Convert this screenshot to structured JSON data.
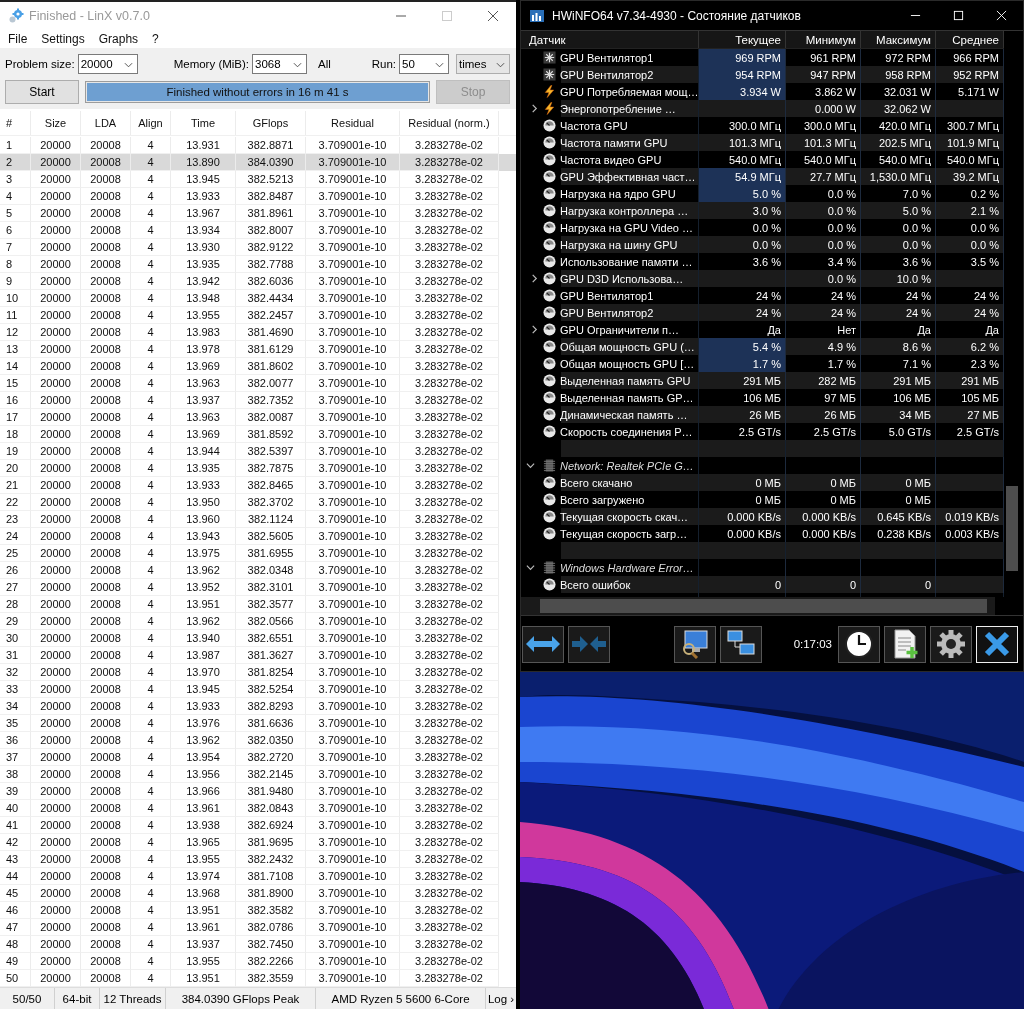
{
  "linx": {
    "title": "Finished - LinX v0.7.0",
    "menu": [
      "File",
      "Settings",
      "Graphs",
      "?"
    ],
    "problem_size": {
      "label": "Problem size:",
      "value": "20000"
    },
    "memory": {
      "label": "Memory (MiB):",
      "value": "3068"
    },
    "all_label": "All",
    "run": {
      "label": "Run:",
      "value": "50",
      "unit": "times"
    },
    "start_button": {
      "label": "Start",
      "disabled": false
    },
    "progress": {
      "text": "Finished without errors in 16 m 41 s",
      "level": 1
    },
    "stop_button": {
      "label": "Stop",
      "disabled": true
    },
    "table": {
      "columns": [
        "#",
        "Size",
        "LDA",
        "Align",
        "Time",
        "GFlops",
        "Residual",
        "Residual (norm.)"
      ],
      "rows": [
        {
          "cells": [
            "1",
            "20000",
            "20008",
            "4",
            "13.931",
            "382.8871",
            "3.709001e-10",
            "3.283278e-02"
          ],
          "selected": false
        },
        {
          "cells": [
            "2",
            "20000",
            "20008",
            "4",
            "13.890",
            "384.0390",
            "3.709001e-10",
            "3.283278e-02"
          ],
          "selected": true
        },
        {
          "cells": [
            "3",
            "20000",
            "20008",
            "4",
            "13.945",
            "382.5213",
            "3.709001e-10",
            "3.283278e-02"
          ],
          "selected": false
        },
        {
          "cells": [
            "4",
            "20000",
            "20008",
            "4",
            "13.933",
            "382.8487",
            "3.709001e-10",
            "3.283278e-02"
          ],
          "selected": false
        },
        {
          "cells": [
            "5",
            "20000",
            "20008",
            "4",
            "13.967",
            "381.8961",
            "3.709001e-10",
            "3.283278e-02"
          ],
          "selected": false
        },
        {
          "cells": [
            "6",
            "20000",
            "20008",
            "4",
            "13.934",
            "382.8007",
            "3.709001e-10",
            "3.283278e-02"
          ],
          "selected": false
        },
        {
          "cells": [
            "7",
            "20000",
            "20008",
            "4",
            "13.930",
            "382.9122",
            "3.709001e-10",
            "3.283278e-02"
          ],
          "selected": false
        },
        {
          "cells": [
            "8",
            "20000",
            "20008",
            "4",
            "13.935",
            "382.7788",
            "3.709001e-10",
            "3.283278e-02"
          ],
          "selected": false
        },
        {
          "cells": [
            "9",
            "20000",
            "20008",
            "4",
            "13.942",
            "382.6036",
            "3.709001e-10",
            "3.283278e-02"
          ],
          "selected": false
        },
        {
          "cells": [
            "10",
            "20000",
            "20008",
            "4",
            "13.948",
            "382.4434",
            "3.709001e-10",
            "3.283278e-02"
          ],
          "selected": false
        },
        {
          "cells": [
            "11",
            "20000",
            "20008",
            "4",
            "13.955",
            "382.2457",
            "3.709001e-10",
            "3.283278e-02"
          ],
          "selected": false
        },
        {
          "cells": [
            "12",
            "20000",
            "20008",
            "4",
            "13.983",
            "381.4690",
            "3.709001e-10",
            "3.283278e-02"
          ],
          "selected": false
        },
        {
          "cells": [
            "13",
            "20000",
            "20008",
            "4",
            "13.978",
            "381.6129",
            "3.709001e-10",
            "3.283278e-02"
          ],
          "selected": false
        },
        {
          "cells": [
            "14",
            "20000",
            "20008",
            "4",
            "13.969",
            "381.8602",
            "3.709001e-10",
            "3.283278e-02"
          ],
          "selected": false
        },
        {
          "cells": [
            "15",
            "20000",
            "20008",
            "4",
            "13.963",
            "382.0077",
            "3.709001e-10",
            "3.283278e-02"
          ],
          "selected": false
        },
        {
          "cells": [
            "16",
            "20000",
            "20008",
            "4",
            "13.937",
            "382.7352",
            "3.709001e-10",
            "3.283278e-02"
          ],
          "selected": false
        },
        {
          "cells": [
            "17",
            "20000",
            "20008",
            "4",
            "13.963",
            "382.0087",
            "3.709001e-10",
            "3.283278e-02"
          ],
          "selected": false
        },
        {
          "cells": [
            "18",
            "20000",
            "20008",
            "4",
            "13.969",
            "381.8592",
            "3.709001e-10",
            "3.283278e-02"
          ],
          "selected": false
        },
        {
          "cells": [
            "19",
            "20000",
            "20008",
            "4",
            "13.944",
            "382.5397",
            "3.709001e-10",
            "3.283278e-02"
          ],
          "selected": false
        },
        {
          "cells": [
            "20",
            "20000",
            "20008",
            "4",
            "13.935",
            "382.7875",
            "3.709001e-10",
            "3.283278e-02"
          ],
          "selected": false
        },
        {
          "cells": [
            "21",
            "20000",
            "20008",
            "4",
            "13.933",
            "382.8465",
            "3.709001e-10",
            "3.283278e-02"
          ],
          "selected": false
        },
        {
          "cells": [
            "22",
            "20000",
            "20008",
            "4",
            "13.950",
            "382.3702",
            "3.709001e-10",
            "3.283278e-02"
          ],
          "selected": false
        },
        {
          "cells": [
            "23",
            "20000",
            "20008",
            "4",
            "13.960",
            "382.1124",
            "3.709001e-10",
            "3.283278e-02"
          ],
          "selected": false
        },
        {
          "cells": [
            "24",
            "20000",
            "20008",
            "4",
            "13.943",
            "382.5605",
            "3.709001e-10",
            "3.283278e-02"
          ],
          "selected": false
        },
        {
          "cells": [
            "25",
            "20000",
            "20008",
            "4",
            "13.975",
            "381.6955",
            "3.709001e-10",
            "3.283278e-02"
          ],
          "selected": false
        },
        {
          "cells": [
            "26",
            "20000",
            "20008",
            "4",
            "13.962",
            "382.0348",
            "3.709001e-10",
            "3.283278e-02"
          ],
          "selected": false
        },
        {
          "cells": [
            "27",
            "20000",
            "20008",
            "4",
            "13.952",
            "382.3101",
            "3.709001e-10",
            "3.283278e-02"
          ],
          "selected": false
        },
        {
          "cells": [
            "28",
            "20000",
            "20008",
            "4",
            "13.951",
            "382.3577",
            "3.709001e-10",
            "3.283278e-02"
          ],
          "selected": false
        },
        {
          "cells": [
            "29",
            "20000",
            "20008",
            "4",
            "13.962",
            "382.0566",
            "3.709001e-10",
            "3.283278e-02"
          ],
          "selected": false
        },
        {
          "cells": [
            "30",
            "20000",
            "20008",
            "4",
            "13.940",
            "382.6551",
            "3.709001e-10",
            "3.283278e-02"
          ],
          "selected": false
        },
        {
          "cells": [
            "31",
            "20000",
            "20008",
            "4",
            "13.987",
            "381.3627",
            "3.709001e-10",
            "3.283278e-02"
          ],
          "selected": false
        },
        {
          "cells": [
            "32",
            "20000",
            "20008",
            "4",
            "13.970",
            "381.8254",
            "3.709001e-10",
            "3.283278e-02"
          ],
          "selected": false
        },
        {
          "cells": [
            "33",
            "20000",
            "20008",
            "4",
            "13.945",
            "382.5254",
            "3.709001e-10",
            "3.283278e-02"
          ],
          "selected": false
        },
        {
          "cells": [
            "34",
            "20000",
            "20008",
            "4",
            "13.933",
            "382.8293",
            "3.709001e-10",
            "3.283278e-02"
          ],
          "selected": false
        },
        {
          "cells": [
            "35",
            "20000",
            "20008",
            "4",
            "13.976",
            "381.6636",
            "3.709001e-10",
            "3.283278e-02"
          ],
          "selected": false
        },
        {
          "cells": [
            "36",
            "20000",
            "20008",
            "4",
            "13.962",
            "382.0350",
            "3.709001e-10",
            "3.283278e-02"
          ],
          "selected": false
        },
        {
          "cells": [
            "37",
            "20000",
            "20008",
            "4",
            "13.954",
            "382.2720",
            "3.709001e-10",
            "3.283278e-02"
          ],
          "selected": false
        },
        {
          "cells": [
            "38",
            "20000",
            "20008",
            "4",
            "13.956",
            "382.2145",
            "3.709001e-10",
            "3.283278e-02"
          ],
          "selected": false
        },
        {
          "cells": [
            "39",
            "20000",
            "20008",
            "4",
            "13.966",
            "381.9480",
            "3.709001e-10",
            "3.283278e-02"
          ],
          "selected": false
        },
        {
          "cells": [
            "40",
            "20000",
            "20008",
            "4",
            "13.961",
            "382.0843",
            "3.709001e-10",
            "3.283278e-02"
          ],
          "selected": false
        },
        {
          "cells": [
            "41",
            "20000",
            "20008",
            "4",
            "13.938",
            "382.6924",
            "3.709001e-10",
            "3.283278e-02"
          ],
          "selected": false
        },
        {
          "cells": [
            "42",
            "20000",
            "20008",
            "4",
            "13.965",
            "381.9695",
            "3.709001e-10",
            "3.283278e-02"
          ],
          "selected": false
        },
        {
          "cells": [
            "43",
            "20000",
            "20008",
            "4",
            "13.955",
            "382.2432",
            "3.709001e-10",
            "3.283278e-02"
          ],
          "selected": false
        },
        {
          "cells": [
            "44",
            "20000",
            "20008",
            "4",
            "13.974",
            "381.7108",
            "3.709001e-10",
            "3.283278e-02"
          ],
          "selected": false
        },
        {
          "cells": [
            "45",
            "20000",
            "20008",
            "4",
            "13.968",
            "381.8900",
            "3.709001e-10",
            "3.283278e-02"
          ],
          "selected": false
        },
        {
          "cells": [
            "46",
            "20000",
            "20008",
            "4",
            "13.951",
            "382.3582",
            "3.709001e-10",
            "3.283278e-02"
          ],
          "selected": false
        },
        {
          "cells": [
            "47",
            "20000",
            "20008",
            "4",
            "13.961",
            "382.0786",
            "3.709001e-10",
            "3.283278e-02"
          ],
          "selected": false
        },
        {
          "cells": [
            "48",
            "20000",
            "20008",
            "4",
            "13.937",
            "382.7450",
            "3.709001e-10",
            "3.283278e-02"
          ],
          "selected": false
        },
        {
          "cells": [
            "49",
            "20000",
            "20008",
            "4",
            "13.955",
            "382.2266",
            "3.709001e-10",
            "3.283278e-02"
          ],
          "selected": false
        },
        {
          "cells": [
            "50",
            "20000",
            "20008",
            "4",
            "13.951",
            "382.3559",
            "3.709001e-10",
            "3.283278e-02"
          ],
          "selected": false
        }
      ]
    },
    "status_bar": [
      "50/50",
      "64-bit",
      "12 Threads",
      "384.0390 GFlops Peak",
      "AMD Ryzen 5 5600 6-Core",
      "Log ›"
    ]
  },
  "hwinfo": {
    "title": "HWiNFO64 v7.34-4930 - Состояние датчиков",
    "columns": [
      "Датчик",
      "Текущее",
      "Минимум",
      "Максимум",
      "Среднее"
    ],
    "rows": [
      {
        "kind": "fan",
        "label": "GPU Вентилятор1",
        "values": {
          "current": "969 RPM",
          "minimum": "961 RPM",
          "maximum": "972 RPM",
          "average": "966 RPM"
        },
        "highlighted": true
      },
      {
        "kind": "fan",
        "label": "GPU Вентилятор2",
        "values": {
          "current": "954 RPM",
          "minimum": "947 RPM",
          "maximum": "958 RPM",
          "average": "952 RPM"
        },
        "highlighted": true
      },
      {
        "kind": "power",
        "label": "GPU Потребляемая мощ…",
        "values": {
          "current": "3.934 W",
          "minimum": "3.862 W",
          "maximum": "32.031 W",
          "average": "5.171 W"
        },
        "highlighted": true
      },
      {
        "kind": "power",
        "label": "Энергопотребление …",
        "values": {
          "minimum": "0.000 W",
          "maximum": "32.062 W"
        },
        "highlighted": false,
        "expanded": false
      },
      {
        "kind": "gauge",
        "label": "Частота GPU",
        "values": [
          "300.0 МГц",
          "300.0 МГц",
          "420.0 МГц",
          "300.7 МГц"
        ],
        "highlighted": false
      },
      {
        "kind": "gauge",
        "label": "Частота памяти GPU",
        "values": [
          "101.3 МГц",
          "101.3 МГц",
          "202.5 МГц",
          "101.9 МГц"
        ],
        "highlighted": false
      },
      {
        "kind": "gauge",
        "label": "Частота видео GPU",
        "values": [
          "540.0 МГц",
          "540.0 МГц",
          "540.0 МГц",
          "540.0 МГц"
        ],
        "highlighted": false
      },
      {
        "kind": "gauge",
        "label": "GPU Эффективная част…",
        "values": [
          "54.9 МГц",
          "27.7 МГц",
          "1,530.0 МГц",
          "39.2 МГц"
        ],
        "highlighted": true
      },
      {
        "kind": "gauge",
        "label": "Нагрузка на ядро GPU",
        "values": [
          "5.0 %",
          "0.0 %",
          "7.0 %",
          "0.2 %"
        ],
        "highlighted": true
      },
      {
        "kind": "gauge",
        "label": "Нагрузка контроллера …",
        "values": [
          "3.0 %",
          "0.0 %",
          "5.0 %",
          "2.1 %"
        ],
        "highlighted": false
      },
      {
        "kind": "gauge",
        "label": "Нагрузка на GPU Video …",
        "values": [
          "0.0 %",
          "0.0 %",
          "0.0 %",
          "0.0 %"
        ],
        "highlighted": false
      },
      {
        "kind": "gauge",
        "label": "Нагрузка на шину GPU",
        "values": [
          "0.0 %",
          "0.0 %",
          "0.0 %",
          "0.0 %"
        ],
        "highlighted": false
      },
      {
        "kind": "gauge",
        "label": "Использование памяти …",
        "values": [
          "3.6 %",
          "3.4 %",
          "3.6 %",
          "3.5 %"
        ],
        "highlighted": false
      },
      {
        "kind": "gauge",
        "label": "GPU D3D Использова…",
        "values": {
          "minimum": "0.0 %",
          "maximum": "10.0 %"
        },
        "highlighted": false,
        "expanded": false
      },
      {
        "kind": "gauge",
        "label": "GPU Вентилятор1",
        "values": [
          "24 %",
          "24 %",
          "24 %",
          "24 %"
        ],
        "highlighted": false
      },
      {
        "kind": "gauge",
        "label": "GPU Вентилятор2",
        "values": [
          "24 %",
          "24 %",
          "24 %",
          "24 %"
        ],
        "highlighted": false
      },
      {
        "kind": "gauge",
        "label": "GPU Ограничители п…",
        "values": [
          "Да",
          "Нет",
          "Да",
          "Да"
        ],
        "highlighted": false,
        "expanded": false
      },
      {
        "kind": "gauge",
        "label": "Общая мощность GPU (…",
        "values": [
          "5.4 %",
          "4.9 %",
          "8.6 %",
          "6.2 %"
        ],
        "highlighted": true
      },
      {
        "kind": "gauge",
        "label": "Общая мощность GPU […",
        "values": [
          "1.7 %",
          "1.7 %",
          "7.1 %",
          "2.3 %"
        ],
        "highlighted": true
      },
      {
        "kind": "gauge",
        "label": "Выделенная память GPU",
        "values": [
          "291 МБ",
          "282 МБ",
          "291 МБ",
          "291 МБ"
        ],
        "highlighted": false
      },
      {
        "kind": "gauge",
        "label": "Выделенная память GP…",
        "values": [
          "106 МБ",
          "97 МБ",
          "106 МБ",
          "105 МБ"
        ],
        "highlighted": false
      },
      {
        "kind": "gauge",
        "label": "Динамическая память …",
        "values": [
          "26 МБ",
          "26 МБ",
          "34 МБ",
          "27 МБ"
        ],
        "highlighted": false
      },
      {
        "kind": "gauge",
        "label": "Скорость соединения P…",
        "values": [
          "2.5 GT/s",
          "2.5 GT/s",
          "5.0 GT/s",
          "2.5 GT/s"
        ],
        "highlighted": false
      },
      {
        "kind": "blank"
      },
      {
        "kind": "group",
        "label": "Network: Realtek PCIe G…",
        "expanded": true,
        "children": [
          {
            "kind": "gauge",
            "label": "Всего скачано",
            "values": {
              "current": "0 МБ",
              "minimum": "0 МБ",
              "maximum": "0 МБ"
            },
            "highlighted": false
          },
          {
            "kind": "gauge",
            "label": "Всего загружено",
            "values": {
              "current": "0 МБ",
              "minimum": "0 МБ",
              "maximum": "0 МБ"
            },
            "highlighted": false
          },
          {
            "kind": "gauge",
            "label": "Текущая скорость скач…",
            "values": [
              "0.000 KB/s",
              "0.000 KB/s",
              "0.645 KB/s",
              "0.019 KB/s"
            ],
            "highlighted": false
          },
          {
            "kind": "gauge",
            "label": "Текущая скорость загр…",
            "values": [
              "0.000 KB/s",
              "0.000 KB/s",
              "0.238 KB/s",
              "0.003 KB/s"
            ],
            "highlighted": false
          }
        ]
      },
      {
        "kind": "blank"
      },
      {
        "kind": "group",
        "label": "Windows Hardware Error…",
        "expanded": true,
        "children": [
          {
            "kind": "gauge",
            "label": "Всего ошибок",
            "values": {
              "current": "0",
              "minimum": "0",
              "maximum": "0"
            },
            "highlighted": false
          }
        ]
      }
    ],
    "elapsed": "0:17:03"
  }
}
